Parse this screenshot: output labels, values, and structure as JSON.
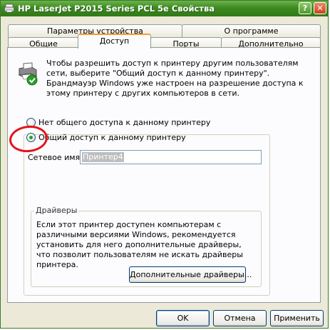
{
  "window": {
    "title": "HP LaserJet P2015 Series PCL 5e Свойства",
    "help_glyph": "?",
    "close_glyph": "✕"
  },
  "tabs": {
    "row1": [
      "Параметры устройства",
      "О программе"
    ],
    "row2": [
      "Общие",
      "Доступ",
      "Порты",
      "Дополнительно"
    ],
    "active": "Доступ"
  },
  "sharing": {
    "intro": "Чтобы разрешить доступ к принтеру другим пользователям сети, выберите \"Общий доступ к данному принтеру\". Брандмауэр Windows уже настроен на разрешение доступа к этому принтеру с других компьютеров в сети.",
    "option_no_share": "Нет общего доступа к данному принтеру",
    "option_share": "Общий доступ к данному принтеру",
    "selected_option": "share",
    "share_name_label": "Сетевое имя:",
    "share_name_value": "Принтер4"
  },
  "drivers": {
    "legend": "Драйверы",
    "text": "Если этот принтер доступен компьютерам с различными версиями Windows, рекомендуется установить для него дополнительные драйверы, что позволит пользователям не искать драйверы принтера.",
    "button": "Дополнительные драйверы..."
  },
  "footer": {
    "ok": "OK",
    "cancel": "Отмена",
    "apply": "Применить"
  },
  "colors": {
    "titlebar": "#3e8a21",
    "annotation": "#e4131b",
    "radio_dot": "#21a121"
  }
}
